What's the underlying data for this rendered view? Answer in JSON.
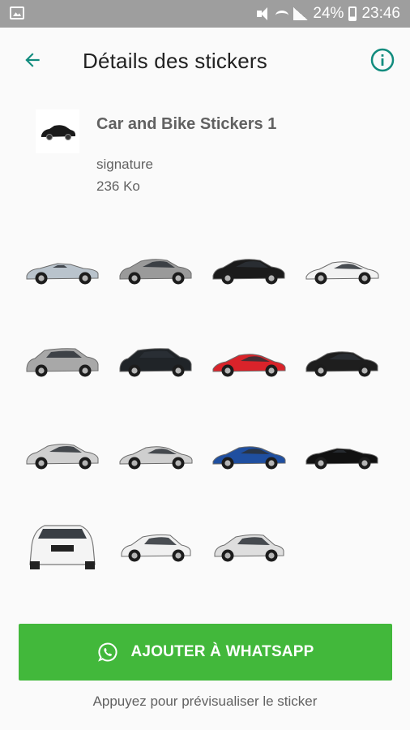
{
  "status_bar": {
    "battery": "24%",
    "time": "23:46"
  },
  "toolbar": {
    "title": "Détails des stickers"
  },
  "pack": {
    "name": "Car and Bike Stickers 1",
    "author": "signature",
    "size": "236 Ko"
  },
  "stickers": [
    {
      "color": "#b9c3cc",
      "style": "convertible"
    },
    {
      "color": "#9a9a9a",
      "style": "sedan"
    },
    {
      "color": "#1b1b1b",
      "style": "sedan"
    },
    {
      "color": "#f2f2f2",
      "style": "coupe"
    },
    {
      "color": "#a8a8a8",
      "style": "suv"
    },
    {
      "color": "#202428",
      "style": "suv"
    },
    {
      "color": "#d9232a",
      "style": "coupe"
    },
    {
      "color": "#1e1e1e",
      "style": "sedan"
    },
    {
      "color": "#d0d0d0",
      "style": "sedan"
    },
    {
      "color": "#cfcfcf",
      "style": "coupe"
    },
    {
      "color": "#1f4fa0",
      "style": "coupe"
    },
    {
      "color": "#111111",
      "style": "convertible"
    },
    {
      "color": "#f4f4f4",
      "style": "front"
    },
    {
      "color": "#f0f0f0",
      "style": "hatch"
    },
    {
      "color": "#dedede",
      "style": "hatch"
    }
  ],
  "actions": {
    "add_label": "AJOUTER À WHATSAPP",
    "hint": "Appuyez pour prévisualiser le sticker"
  },
  "colors": {
    "accent": "#128c7e",
    "button": "#42b83b",
    "status_bar": "#9e9e9e"
  }
}
